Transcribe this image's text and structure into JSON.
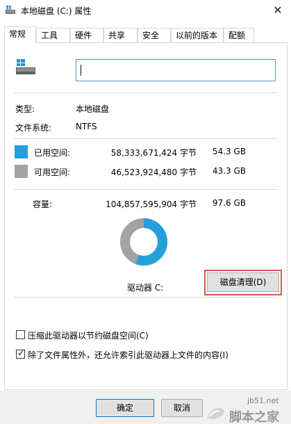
{
  "window": {
    "title": "本地磁盘 (C:) 属性",
    "close_icon": "close-icon"
  },
  "tabs": [
    {
      "label": "常规",
      "active": true
    },
    {
      "label": "工具"
    },
    {
      "label": "硬件"
    },
    {
      "label": "共享"
    },
    {
      "label": "安全"
    },
    {
      "label": "以前的版本"
    },
    {
      "label": "配额"
    }
  ],
  "general": {
    "name_value": "",
    "type_label": "类型:",
    "type_value": "本地磁盘",
    "fs_label": "文件系统:",
    "fs_value": "NTFS",
    "used": {
      "label": "已用空间:",
      "bytes": "58,333,671,424 字节",
      "size": "54.3 GB",
      "color": "#26a0da"
    },
    "free": {
      "label": "可用空间:",
      "bytes": "46,523,924,480 字节",
      "size": "43.3 GB",
      "color": "#a3a3a3"
    },
    "capacity": {
      "label": "容量:",
      "bytes": "104,857,595,904 字节",
      "size": "97.6 GB"
    },
    "drive_label": "驱动器 C:",
    "used_fraction": 0.556,
    "cleanup_button": "磁盘清理(D)",
    "compress_label": "压缩此驱动器以节约磁盘空间(C)",
    "compress_checked": false,
    "index_label": "除了文件属性外，还允许索引此驱动器上文件的内容(I)",
    "index_checked": true
  },
  "buttons": {
    "ok": "确定",
    "cancel": "取消"
  },
  "watermark": {
    "line1": "jb51.net",
    "line2": "脚本之家"
  }
}
